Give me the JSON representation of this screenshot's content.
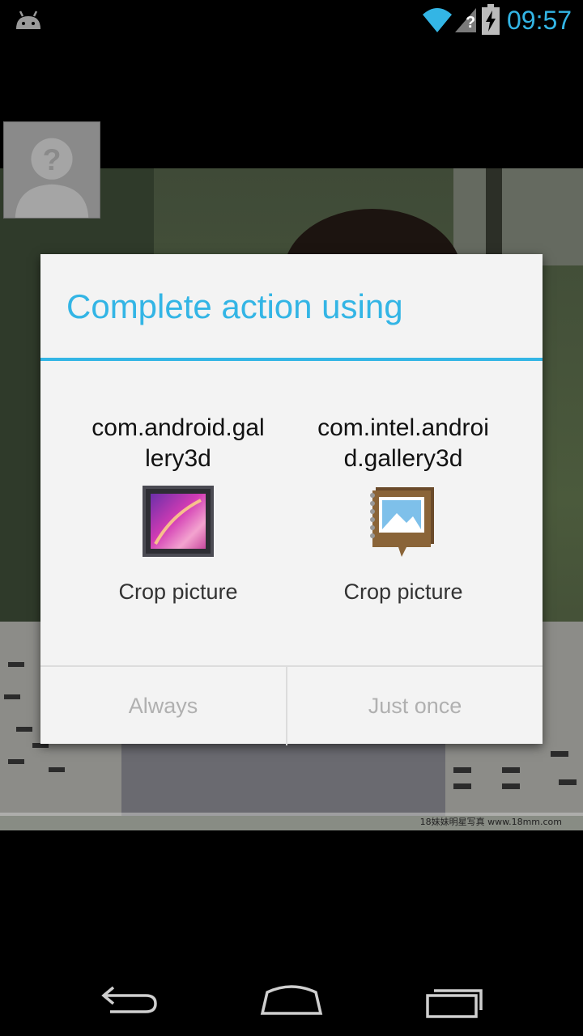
{
  "status_bar": {
    "time": "09:57",
    "icons": [
      "android-debug-icon",
      "wifi-icon",
      "no-sim-signal-icon",
      "battery-charging-icon"
    ],
    "accent_color": "#33b5e5"
  },
  "dialog": {
    "title": "Complete action using",
    "options": [
      {
        "package": "com.android.gallery3d",
        "label": "Crop picture",
        "icon": "gallery-icon"
      },
      {
        "package": "com.intel.android.gallery3d",
        "label": "Crop picture",
        "icon": "photo-album-icon"
      }
    ],
    "buttons": {
      "always": "Always",
      "just_once": "Just once"
    },
    "accent_color": "#33b5e5"
  },
  "background": {
    "watermark": "18妹妹明星写真 www.18mm.com"
  },
  "nav_bar": {
    "icons": [
      "back-icon",
      "home-icon",
      "recent-apps-icon"
    ]
  }
}
